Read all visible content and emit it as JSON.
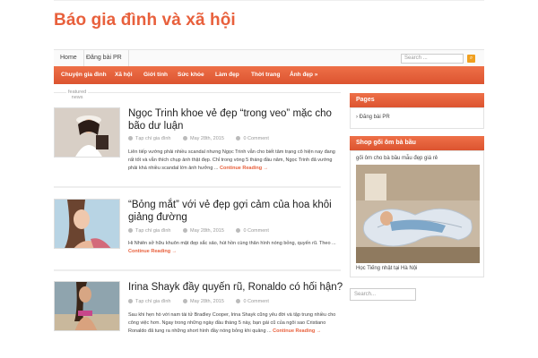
{
  "site": {
    "title": "Báo gia đình và xã hội"
  },
  "top_nav": {
    "items": [
      "Home",
      "Đăng bài PR"
    ],
    "search_placeholder": "Search ..."
  },
  "main_nav": {
    "items": [
      "Chuyện gia đình",
      "Xã hội",
      "Giới tính",
      "Sức khỏe",
      "Làm đẹp",
      "Thời trang",
      "Ảnh đẹp »"
    ]
  },
  "featured_label": "featured\nnews",
  "posts": [
    {
      "title": "Ngọc Trinh khoe vẻ đẹp “trong veo” mặc cho bão dư luận",
      "category": "Tạp chí gia đình",
      "date": "May 28th, 2015",
      "comments": "0 Comment",
      "excerpt": "Liên tiếp vướng phải nhiều scandal nhưng Ngọc Trinh vẫn cho biết tâm trạng cô hiện nay đang rất tốt và vẫn thích chụp ảnh thật đẹp. Chỉ trong vòng 5 tháng đầu năm, Ngọc Trinh đã vướng phải khá nhiều scandal lớn ảnh hưởng ...",
      "more": "Continue Reading →"
    },
    {
      "title": "“Bỏng mắt” với vẻ đẹp gợi cảm của hoa khôi giảng đường",
      "category": "Tạp chí gia đình",
      "date": "May 28th, 2015",
      "comments": "0 Comment",
      "excerpt": "Hi Nhiên sở hữu khuôn mặt đẹp sắc sảo, hút hồn cùng thân hình nóng bỏng, quyến rũ.                                    Theo ...",
      "more": "Continue Reading →"
    },
    {
      "title": "Irina Shayk đầy quyến rũ, Ronaldo có hối hận?",
      "category": "Tạp chí gia đình",
      "date": "May 28th, 2015",
      "comments": "0 Comment",
      "excerpt": "Sau khi hẹn hò với nam tài tử Bradley Cooper, Irina Shayk cũng yêu đời và tập trung nhiều cho công việc hơn. Ngay trong những ngày đầu tháng 5 này, bạn gái cũ của ngôi sao Cristiano Ronaldo đã tung ra những short hình đầy nóng bỏng khi quảng ...",
      "more": "Continue Reading →"
    }
  ],
  "sidebar": {
    "pages_title": "Pages",
    "pages_items": [
      "Đăng bài PR"
    ],
    "shop_title": "Shop gối ôm bà bầu",
    "shop_caption": "gối ôm cho bà bầu mẫu đẹp giá rẻ",
    "shop_link": "Học Tiếng nhật tại Hà Nội",
    "search_placeholder": "Search..."
  },
  "colors": {
    "accent": "#e8603c"
  }
}
